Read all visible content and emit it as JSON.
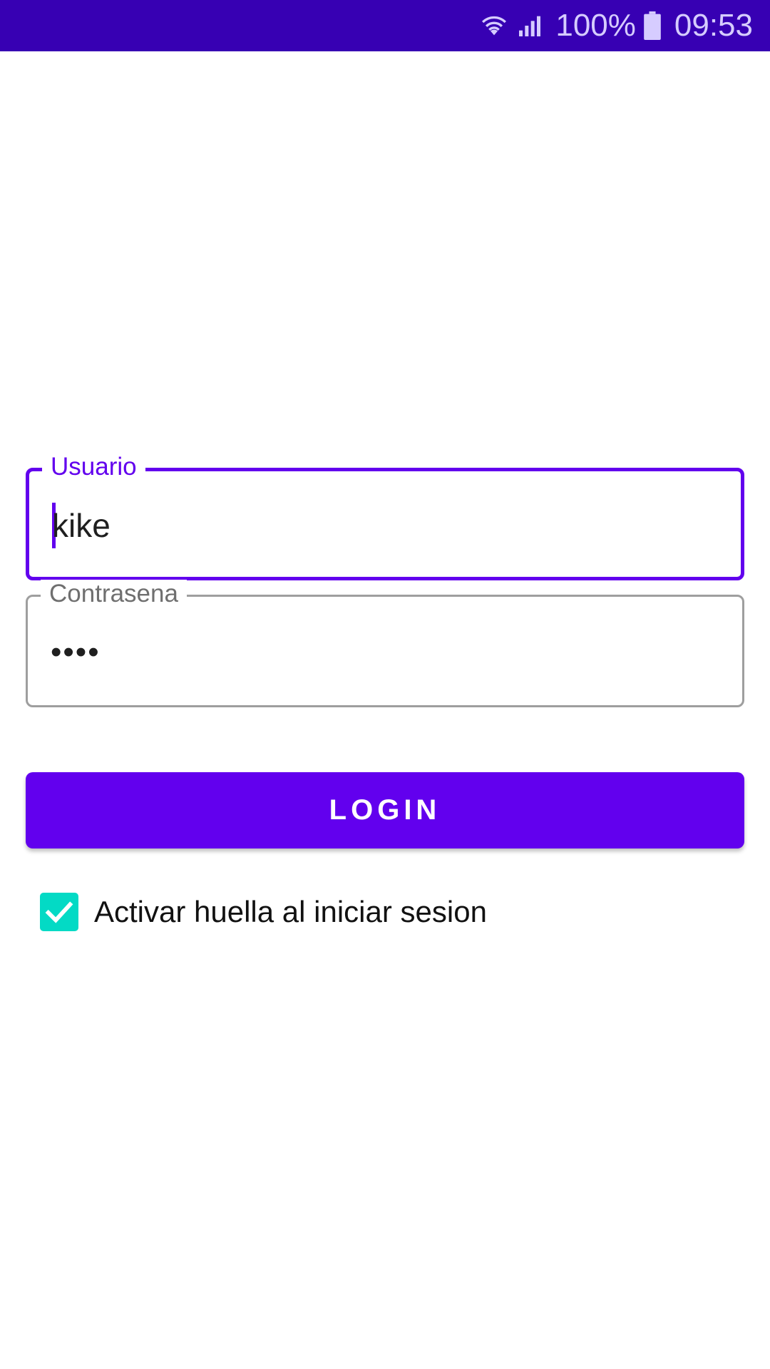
{
  "status_bar": {
    "battery_percent": "100%",
    "time": "09:53",
    "icons": [
      "wifi-icon",
      "signal-icon",
      "battery-icon"
    ]
  },
  "form": {
    "username": {
      "label": "Usuario",
      "value": "kike",
      "focused": true
    },
    "password": {
      "label": "Contrasena",
      "value": "••••"
    },
    "login_label": "LOGIN",
    "fingerprint_checkbox": {
      "label": "Activar huella al iniciar sesion",
      "checked": true
    }
  },
  "colors": {
    "status_bar": "#3700b3",
    "primary": "#6200ee",
    "checkbox": "#03dac5",
    "outline": "#9e9e9e"
  }
}
